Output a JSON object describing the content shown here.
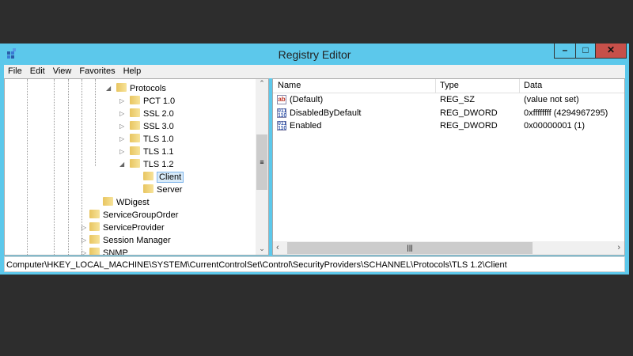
{
  "window": {
    "title": "Registry Editor",
    "minimize": "–",
    "maximize": "□",
    "close": "✕"
  },
  "menu": [
    "File",
    "Edit",
    "View",
    "Favorites",
    "Help"
  ],
  "tree": [
    {
      "label": "Protocols",
      "expander": "◢",
      "level": 0
    },
    {
      "label": "PCT 1.0",
      "expander": "▷",
      "level": 1
    },
    {
      "label": "SSL 2.0",
      "expander": "▷",
      "level": 1
    },
    {
      "label": "SSL 3.0",
      "expander": "▷",
      "level": 1
    },
    {
      "label": "TLS 1.0",
      "expander": "▷",
      "level": 1
    },
    {
      "label": "TLS 1.1",
      "expander": "▷",
      "level": 1
    },
    {
      "label": "TLS 1.2",
      "expander": "◢",
      "level": 1
    },
    {
      "label": "Client",
      "expander": "",
      "level": 2,
      "selected": true
    },
    {
      "label": "Server",
      "expander": "",
      "level": 2
    },
    {
      "label": "WDigest",
      "expander": "",
      "level": -1
    },
    {
      "label": "ServiceGroupOrder",
      "expander": "",
      "level": -2
    },
    {
      "label": "ServiceProvider",
      "expander": "▷",
      "level": -2
    },
    {
      "label": "Session Manager",
      "expander": "▷",
      "level": -2
    },
    {
      "label": "SNMP",
      "expander": "▷",
      "level": -2
    }
  ],
  "list": {
    "columns": [
      "Name",
      "Type",
      "Data"
    ],
    "rows": [
      {
        "icon": "ab",
        "name": "(Default)",
        "type": "REG_SZ",
        "data": "(value not set)"
      },
      {
        "icon": "binary",
        "name": "DisabledByDefault",
        "type": "REG_DWORD",
        "data": "0xffffffff (4294967295)"
      },
      {
        "icon": "binary",
        "name": "Enabled",
        "type": "REG_DWORD",
        "data": "0x00000001 (1)"
      }
    ]
  },
  "status_path": "Computer\\HKEY_LOCAL_MACHINE\\SYSTEM\\CurrentControlSet\\Control\\SecurityProviders\\SCHANNEL\\Protocols\\TLS 1.2\\Client"
}
